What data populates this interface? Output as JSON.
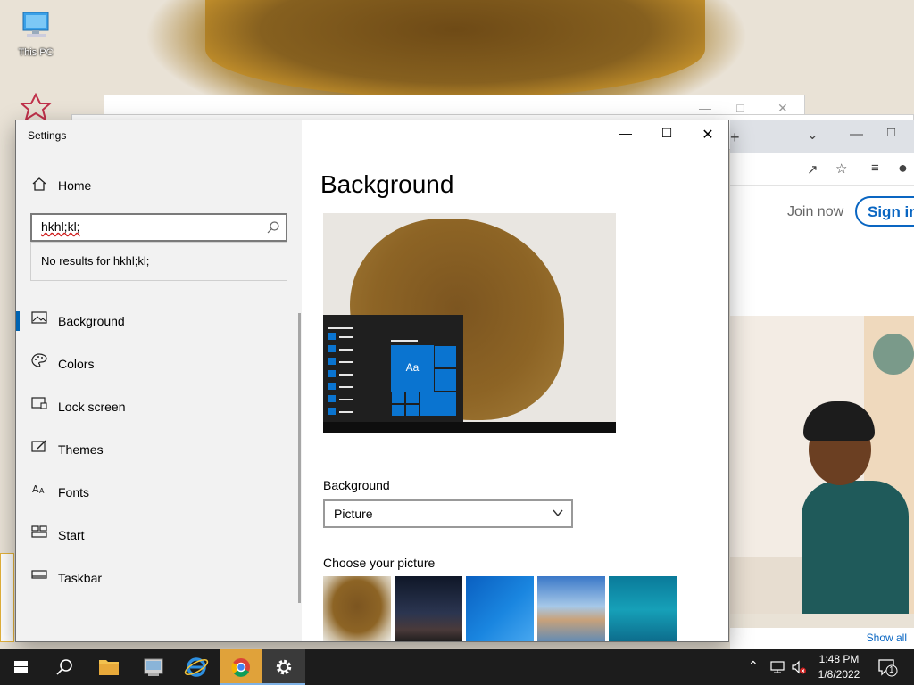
{
  "desktop": {
    "icons": [
      {
        "label": "This PC"
      }
    ]
  },
  "browser": {
    "join_label": "Join now",
    "signin_label": "Sign in",
    "show_all_label": "Show all"
  },
  "settings": {
    "window_title": "Settings",
    "home_label": "Home",
    "search": {
      "value": "hkhl;kl;",
      "no_results": "No results for hkhl;kl;"
    },
    "nav_items": [
      {
        "label": "Background",
        "icon": "picture-icon",
        "selected": true
      },
      {
        "label": "Colors",
        "icon": "palette-icon"
      },
      {
        "label": "Lock screen",
        "icon": "lock-screen-icon"
      },
      {
        "label": "Themes",
        "icon": "themes-icon"
      },
      {
        "label": "Fonts",
        "icon": "fonts-icon"
      },
      {
        "label": "Start",
        "icon": "start-icon"
      },
      {
        "label": "Taskbar",
        "icon": "taskbar-icon"
      }
    ],
    "page_title": "Background",
    "preview_tile_label": "Aa",
    "background_label": "Background",
    "background_value": "Picture",
    "choose_picture_label": "Choose your picture",
    "accent_color": "#0063b1"
  },
  "taskbar": {
    "time": "1:48 PM",
    "date": "1/8/2022",
    "notification_count": "1"
  }
}
